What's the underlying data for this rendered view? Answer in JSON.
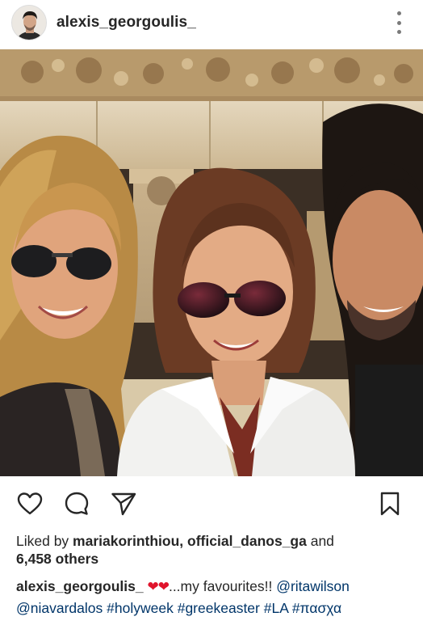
{
  "header": {
    "username": "alexis_georgoulis_"
  },
  "actions": {
    "like_icon": "heart-outline-icon",
    "comment_icon": "comment-bubble-icon",
    "share_icon": "paper-plane-icon",
    "save_icon": "bookmark-icon"
  },
  "likes": {
    "prefix": "Liked by ",
    "user1": "mariakorinthiou",
    "separator": ", ",
    "user2": "official_danos_ga",
    "and_text": " and",
    "others": "6,458 others"
  },
  "caption": {
    "username": "alexis_georgoulis_",
    "hearts": "❤❤",
    "text": "...my favourites!! ",
    "mention1": "@ritawilson",
    "mention2": "@niavardalos",
    "tag1": "#holyweek",
    "tag2": "#greekeaster",
    "tag3": "#LA",
    "tag4": "#πασχα"
  },
  "colors": {
    "text": "#262626",
    "link": "#003569",
    "heart": "#e0142c"
  }
}
